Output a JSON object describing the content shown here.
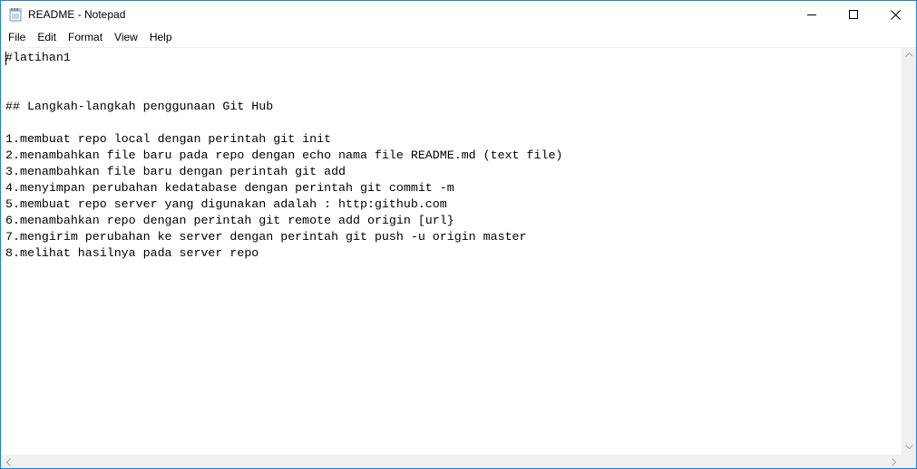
{
  "window": {
    "title": "README - Notepad",
    "app_icon": "notepad-icon",
    "controls": {
      "minimize_icon": "minimize-icon",
      "maximize_icon": "maximize-icon",
      "close_icon": "close-icon"
    }
  },
  "menu": {
    "items": [
      {
        "label": "File"
      },
      {
        "label": "Edit"
      },
      {
        "label": "Format"
      },
      {
        "label": "View"
      },
      {
        "label": "Help"
      }
    ]
  },
  "editor": {
    "lines": [
      "#latihan1",
      "",
      "",
      "## Langkah-langkah penggunaan Git Hub",
      "",
      "1.membuat repo local dengan perintah git init",
      "2.menambahkan file baru pada repo dengan echo nama file README.md (text file)",
      "3.menambahkan file baru dengan perintah git add",
      "4.menyimpan perubahan kedatabase dengan perintah git commit -m",
      "5.membuat repo server yang digunakan adalah : http:github.com",
      "6.menambahkan repo dengan perintah git remote add origin [url}",
      "7.mengirim perubahan ke server dengan perintah git push -u origin master",
      "8.melihat hasilnya pada server repo"
    ]
  },
  "colors": {
    "window_border": "#1883d7",
    "scrollbar_bg": "#f0f0f0",
    "arrow_color": "#a3a3a3",
    "text": "#000000"
  }
}
